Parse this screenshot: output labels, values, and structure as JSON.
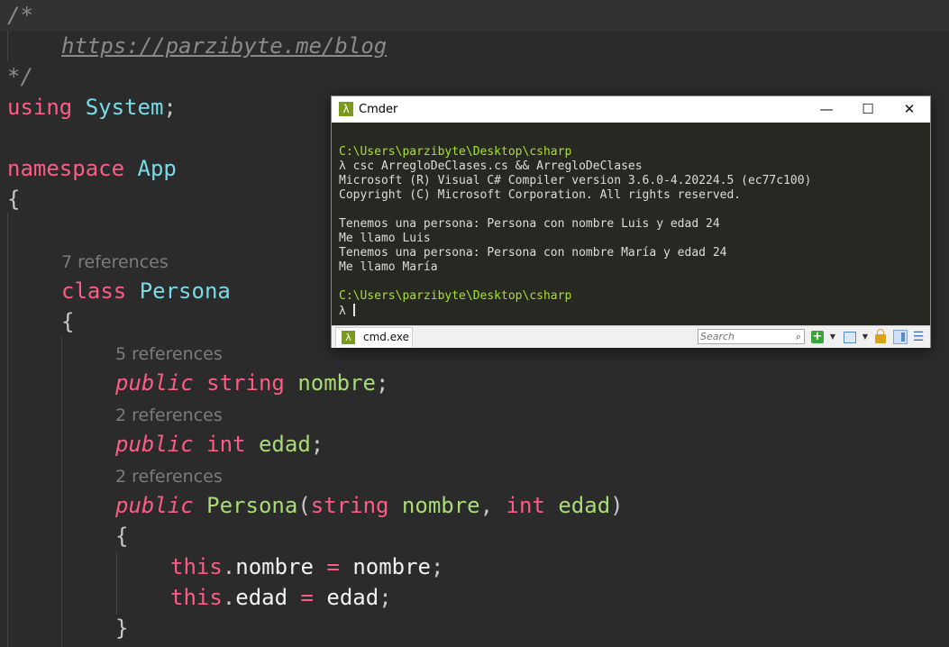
{
  "editor": {
    "lines": {
      "comment_open": "/*",
      "url": "https://parzibyte.me/blog",
      "comment_close": "*/",
      "using_kw": "using",
      "using_ns": "System",
      "semicolon": ";",
      "namespace_kw": "namespace",
      "namespace_name": "App",
      "brace_open": "{",
      "brace_close": "}",
      "class_kw": "class",
      "class_name": "Persona",
      "public_kw": "public",
      "string_kw": "string",
      "int_kw": "int",
      "field_nombre": "nombre",
      "field_edad": "edad",
      "ctor_name": "Persona",
      "paren_open": "(",
      "paren_close": ")",
      "comma": ",",
      "this_kw": "this",
      "dot": ".",
      "assign": "="
    },
    "codelens": {
      "class_refs": "7 references",
      "nombre_refs": "5 references",
      "edad_refs": "2 references",
      "ctor_refs": "2 references"
    }
  },
  "cmder": {
    "title": "Cmder",
    "icon_glyph": "λ",
    "controls": {
      "minimize": "—",
      "maximize": "☐",
      "close": "✕"
    },
    "console": {
      "prompt_path": "C:\\Users\\parzibyte\\Desktop\\csharp",
      "prompt_symbol": "λ",
      "command": " csc ArregloDeClases.cs && ArregloDeClases",
      "output": [
        "Microsoft (R) Visual C# Compiler version 3.6.0-4.20224.5 (ec77c100)",
        "Copyright (C) Microsoft Corporation. All rights reserved.",
        "",
        "Tenemos una persona: Persona con nombre Luis y edad 24",
        "Me llamo Luis",
        "Tenemos una persona: Persona con nombre María y edad 24",
        "Me llamo María"
      ]
    },
    "tab": {
      "label": "cmd.exe",
      "icon_glyph": "λ"
    },
    "search": {
      "placeholder": "Search"
    },
    "toolbar_icons": [
      "plus-icon",
      "chevron-down-icon",
      "grid-icon",
      "chevron-down-icon",
      "lock-icon",
      "pane-icon",
      "menu-icon"
    ],
    "colors": {
      "console_bg": "#272822",
      "path_green": "#a6e22e",
      "icon_green": "#7a9a1c"
    }
  },
  "colors": {
    "editor_bg": "#2b2b2b",
    "keyword": "#fc5c85",
    "type": "#78dce8",
    "identifier": "#a9dc76",
    "comment": "#8a8a8a"
  }
}
